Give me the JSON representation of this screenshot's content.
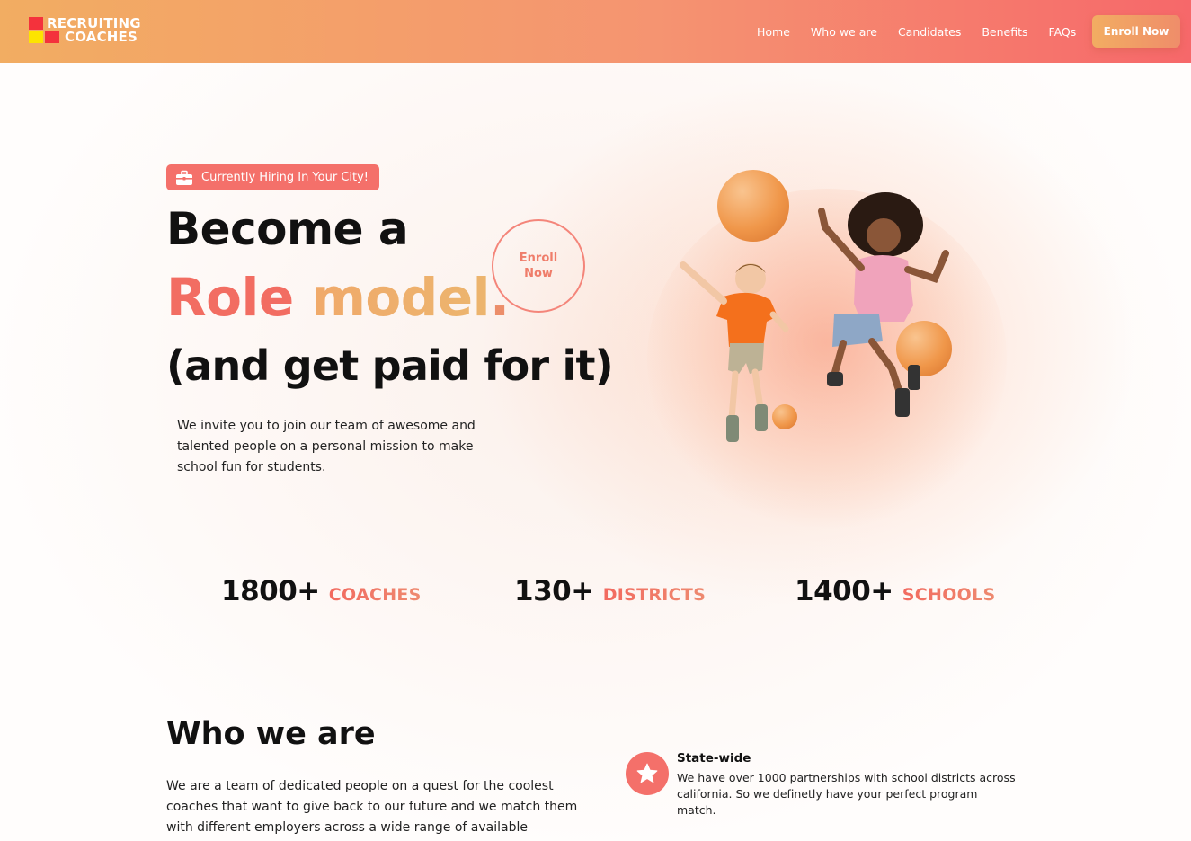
{
  "brand": {
    "logo_line1": "RECRUITING",
    "logo_line2": "COACHES",
    "colors": {
      "red": "#f4323c",
      "yellow": "#fde400",
      "accent": "#f4706a",
      "orange": "#f2ad62"
    }
  },
  "nav": {
    "items": [
      {
        "label": "Home"
      },
      {
        "label": "Who we are"
      },
      {
        "label": "Candidates"
      },
      {
        "label": "Benefits"
      },
      {
        "label": "FAQs"
      }
    ],
    "cta_label": "Enroll Now"
  },
  "hero": {
    "badge_icon": "briefcase-icon",
    "badge_text": "Currently Hiring In Your City!",
    "headline_line1": "Become a",
    "headline_role": "Role",
    "headline_model": "model",
    "headline_dot": ".",
    "headline_line3": "(and get paid for it)",
    "circle_cta": "Enroll Now",
    "description": "We invite you to join our team of awesome and talented people on a personal mission to make school fun for students."
  },
  "stats": [
    {
      "number": "1800+",
      "label": "COACHES"
    },
    {
      "number": "130+",
      "label": "DISTRICTS"
    },
    {
      "number": "1400+",
      "label": "SCHOOLS"
    }
  ],
  "who": {
    "title": "Who we are",
    "description": "We are a team of dedicated people on a quest for the coolest coaches that want to give back to our future and we match them with different employers across a wide range of available programs.",
    "feature": {
      "icon": "star-icon",
      "title": "State-wide",
      "description": "We have over 1000 partnerships with school districts across california. So we definetly have your perfect program match."
    }
  }
}
